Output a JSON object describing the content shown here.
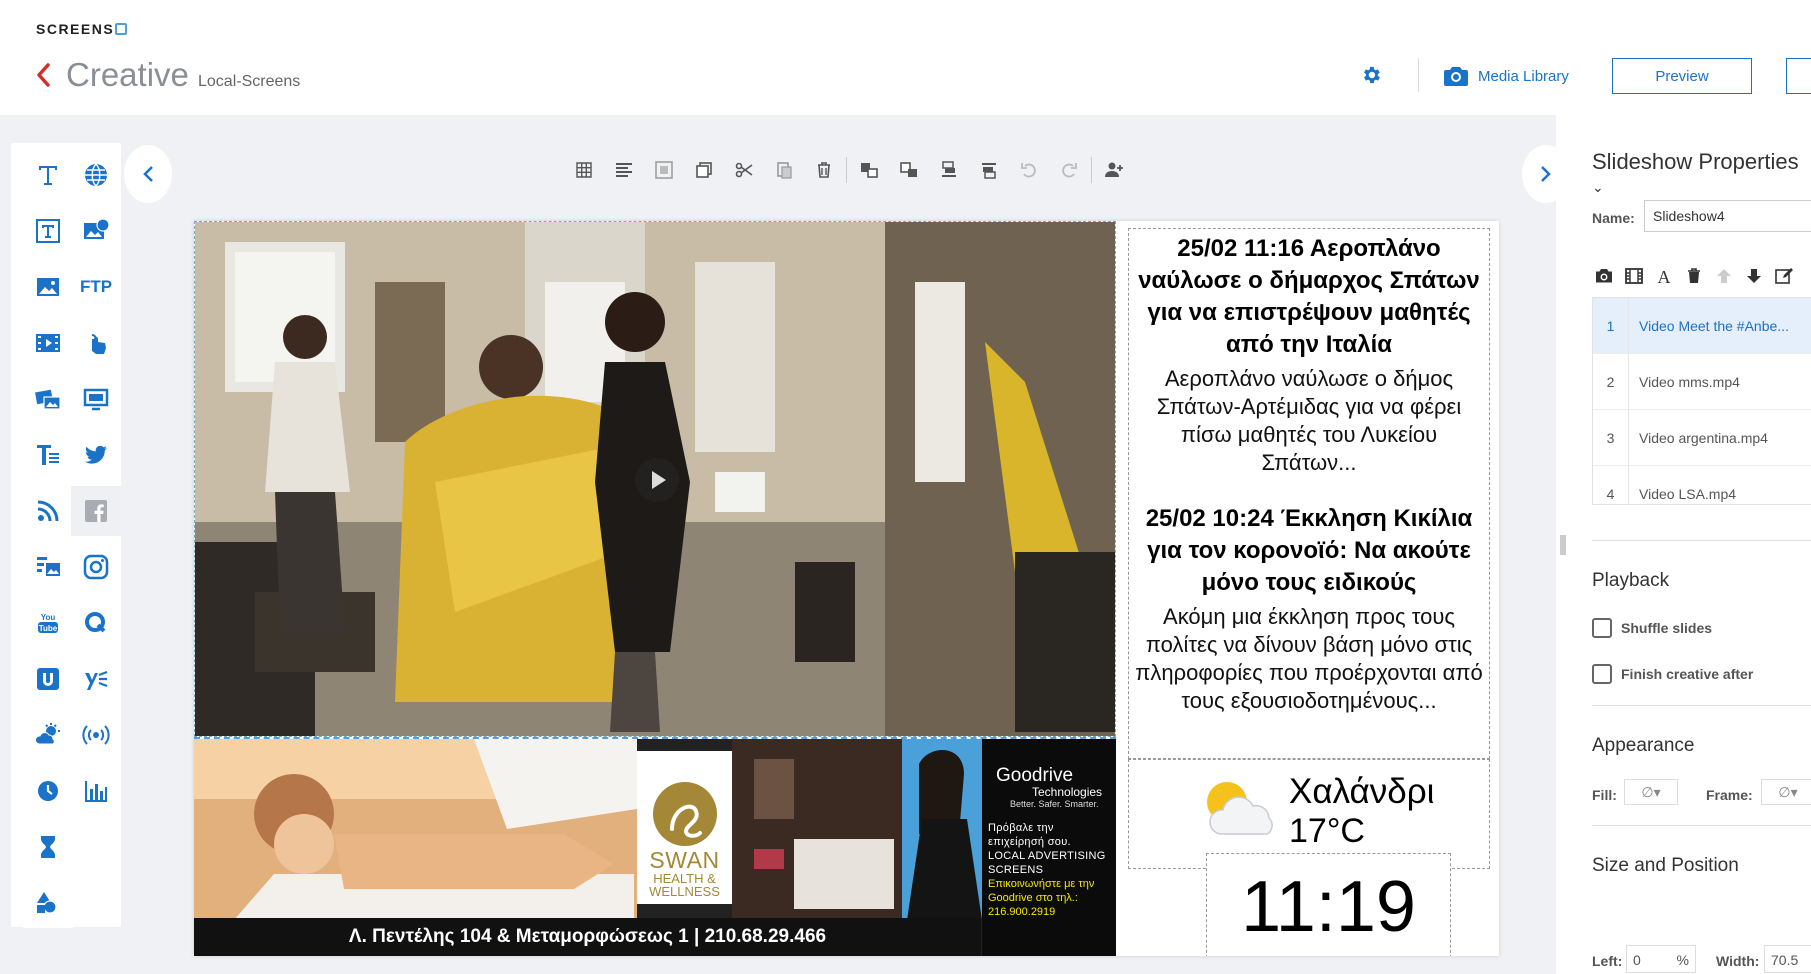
{
  "header": {
    "logo_text": "SCREENS",
    "title": "Creative",
    "subtitle": "Local-Screens",
    "media_library_label": "Media Library",
    "preview_label": "Preview"
  },
  "toolbar": {
    "tools": [
      "grid-icon",
      "align-icon",
      "fit-icon",
      "duplicate-icon",
      "cut-icon",
      "paste-icon",
      "delete-icon",
      "send-backward-icon",
      "bring-forward-icon",
      "send-to-back-icon",
      "bring-to-front-icon",
      "undo-icon",
      "redo-icon",
      "add-user-icon"
    ]
  },
  "palette": {
    "ftp_label": "FTP",
    "items": [
      "text",
      "web",
      "text-box",
      "image-web",
      "image",
      "ftp",
      "video",
      "touch",
      "slideshow",
      "screen",
      "ticker",
      "twitter",
      "rss",
      "facebook",
      "dynamic-media",
      "instagram",
      "youtube",
      "qr",
      "ustream",
      "yammer",
      "weather",
      "broadcast",
      "clock",
      "chart",
      "countdown",
      "shapes"
    ],
    "selected": "facebook"
  },
  "stage": {
    "ad_caption": "Λ. Πεντέλης 104 & Μεταμορφώσεως 1 | 210.68.29.466",
    "swan_name": "SWAN",
    "swan_sub": "HEALTH & WELLNESS",
    "goodrive_logo": "Goodrive",
    "goodrive_logo_sub": "Technologies",
    "goodrive_tag": "Better. Safer. Smarter.",
    "goodrive_text": "Πρόβαλε την επιχείρησή σου. LOCAL ADVERTISING SCREENS",
    "goodrive_contact": "Επικοινωνήστε με την Goodrive στο τηλ.: 216.900.2919",
    "news": [
      {
        "title": "25/02 11:16 Αεροπλάνο ναύλωσε ο δήμαρχος Σπάτων για να επιστρέψουν μαθητές από την Ιταλία",
        "body": "Αεροπλάνο ναύλωσε ο δήμος Σπάτων-Αρτέμιδας για να φέρει πίσω μαθητές του Λυκείου Σπάτων..."
      },
      {
        "title": "25/02 10:24 Έκκληση Κικίλια για τον κορονοϊό: Να ακούτε μόνο τους ειδικούς",
        "body": "Ακόμη μια έκκληση προς τους πολίτες να δίνουν βάση μόνο στις πληροφορίες που προέρχονται από τους εξουσιοδοτημένους..."
      }
    ],
    "weather_city": "Χαλάνδρι",
    "weather_temp": "17°C",
    "clock_time": "11:19"
  },
  "properties": {
    "title": "Slideshow Properties",
    "name_label": "Name:",
    "name_value": "Slideshow4",
    "slides": [
      {
        "num": "1",
        "label": "Video Meet the #Anbe..."
      },
      {
        "num": "2",
        "label": "Video mms.mp4"
      },
      {
        "num": "3",
        "label": "Video argentina.mp4"
      },
      {
        "num": "4",
        "label": "Video LSA.mp4"
      }
    ],
    "playback_title": "Playback",
    "shuffle_label": "Shuffle slides",
    "finish_label": "Finish creative after",
    "appearance_title": "Appearance",
    "fill_label": "Fill:",
    "frame_label": "Frame:",
    "size_title": "Size and Position",
    "left_label": "Left:",
    "left_value": "0",
    "left_unit": "%",
    "width_label": "Width:",
    "width_value": "70.5"
  },
  "colors": {
    "accent": "#1a73c8",
    "back_arrow": "#d0312d"
  }
}
